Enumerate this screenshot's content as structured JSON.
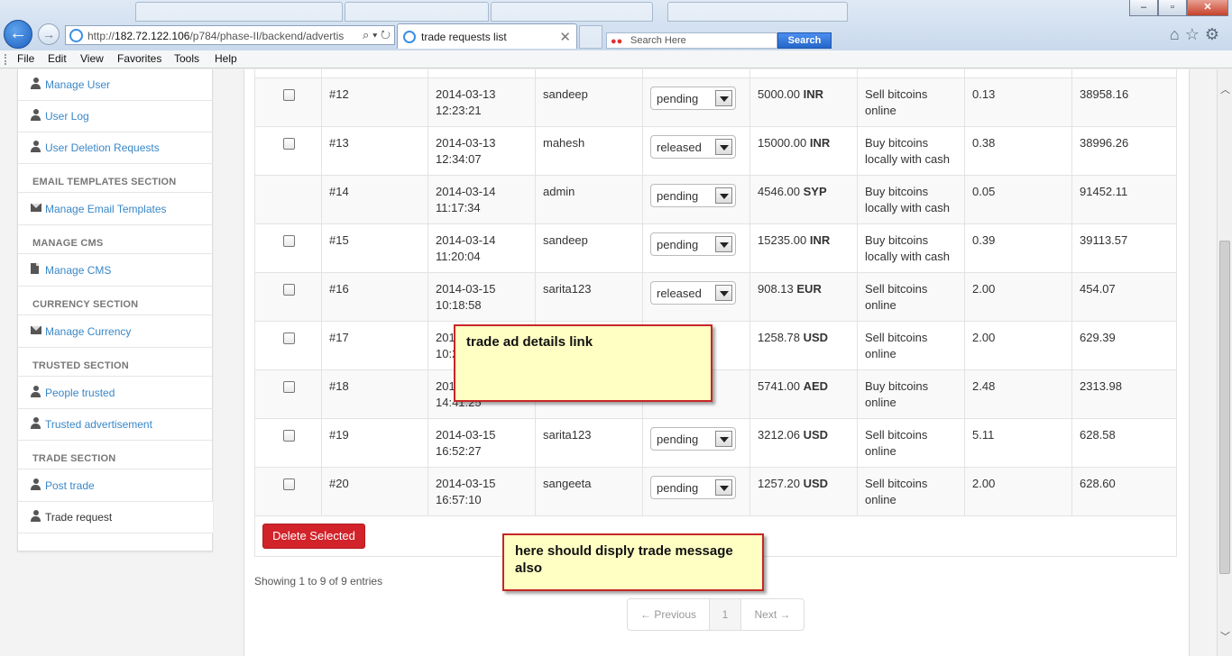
{
  "browser": {
    "address_url_host": "182.72.122.106",
    "address_url_prefix": "http://",
    "address_url_path": "/p784/phase-II/backend/advertis",
    "active_tab_title": "trade requests list",
    "search_placeholder": "Search Here",
    "search_button": "Search",
    "menu": [
      "File",
      "Edit",
      "View",
      "Favorites",
      "Tools",
      "Help"
    ]
  },
  "sidebar": {
    "items": [
      {
        "type": "link",
        "icon": "user-icon",
        "label": "Manage User"
      },
      {
        "type": "link",
        "icon": "user-icon",
        "label": "User Log"
      },
      {
        "type": "link",
        "icon": "user-icon",
        "label": "User Deletion Requests"
      },
      {
        "type": "head",
        "label": "EMAIL TEMPLATES SECTION"
      },
      {
        "type": "link",
        "icon": "envelope-icon",
        "label": "Manage Email Templates"
      },
      {
        "type": "head",
        "label": "MANAGE CMS"
      },
      {
        "type": "link",
        "icon": "document-icon",
        "label": "Manage CMS"
      },
      {
        "type": "head",
        "label": "CURRENCY SECTION"
      },
      {
        "type": "link",
        "icon": "envelope-icon",
        "label": "Manage Currency"
      },
      {
        "type": "head",
        "label": "TRUSTED SECTION"
      },
      {
        "type": "link",
        "icon": "user-icon",
        "label": "People trusted"
      },
      {
        "type": "link",
        "icon": "user-icon",
        "label": "Trusted advertisement"
      },
      {
        "type": "head",
        "label": "TRADE SECTION"
      },
      {
        "type": "link",
        "icon": "user-icon",
        "label": "Post trade"
      },
      {
        "type": "link",
        "icon": "user-icon",
        "label": "Trade request",
        "active": true
      }
    ]
  },
  "table": {
    "rows": [
      {
        "id": "#12",
        "date": "2014-03-13",
        "time": "12:23:21",
        "user": "sandeep",
        "status": "pending",
        "amount": "5000.00",
        "currency": "INR",
        "ad_line1": "Sell bitcoins",
        "ad_line2": "online",
        "btc": "0.13",
        "price": "38958.16",
        "checkbox": true
      },
      {
        "id": "#13",
        "date": "2014-03-13",
        "time": "12:34:07",
        "user": "mahesh",
        "status": "released",
        "amount": "15000.00",
        "currency": "INR",
        "ad_line1": "Buy bitcoins",
        "ad_line2": "locally with cash",
        "btc": "0.38",
        "price": "38996.26",
        "checkbox": true
      },
      {
        "id": "#14",
        "date": "2014-03-14",
        "time": "11:17:34",
        "user": "admin",
        "status": "pending",
        "amount": "4546.00",
        "currency": "SYP",
        "ad_line1": "Buy bitcoins",
        "ad_line2": "locally with cash",
        "btc": "0.05",
        "price": "91452.11",
        "checkbox": false
      },
      {
        "id": "#15",
        "date": "2014-03-14",
        "time": "11:20:04",
        "user": "sandeep",
        "status": "pending",
        "amount": "15235.00",
        "currency": "INR",
        "ad_line1": "Buy bitcoins",
        "ad_line2": "locally with cash",
        "btc": "0.39",
        "price": "39113.57",
        "checkbox": true
      },
      {
        "id": "#16",
        "date": "2014-03-15",
        "time": "10:18:58",
        "user": "sarita123",
        "status": "released",
        "amount": "908.13",
        "currency": "EUR",
        "ad_line1": "Sell bitcoins",
        "ad_line2": "online",
        "btc": "2.00",
        "price": "454.07",
        "checkbox": true
      },
      {
        "id": "#17",
        "date": "201",
        "time": "10:2",
        "user": "",
        "status": "",
        "amount": "1258.78",
        "currency": "USD",
        "ad_line1": "Sell bitcoins",
        "ad_line2": "online",
        "btc": "2.00",
        "price": "629.39",
        "checkbox": true
      },
      {
        "id": "#18",
        "date": "201",
        "time": "14:41:25",
        "user": "",
        "status": "",
        "amount": "5741.00",
        "currency": "AED",
        "ad_line1": "Buy bitcoins",
        "ad_line2": "online",
        "btc": "2.48",
        "price": "2313.98",
        "checkbox": true
      },
      {
        "id": "#19",
        "date": "2014-03-15",
        "time": "16:52:27",
        "user": "sarita123",
        "status": "pending",
        "amount": "3212.06",
        "currency": "USD",
        "ad_line1": "Sell bitcoins",
        "ad_line2": "online",
        "btc": "5.11",
        "price": "628.58",
        "checkbox": true
      },
      {
        "id": "#20",
        "date": "2014-03-15",
        "time": "16:57:10",
        "user": "sangeeta",
        "status": "pending",
        "amount": "1257.20",
        "currency": "USD",
        "ad_line1": "Sell bitcoins",
        "ad_line2": "online",
        "btc": "2.00",
        "price": "628.60",
        "checkbox": true
      }
    ],
    "delete_button": "Delete Selected",
    "showing_text": "Showing 1 to 9 of 9 entries",
    "pager": {
      "previous": "← Previous",
      "page": "1",
      "next": "Next →"
    }
  },
  "annotations": {
    "note1": "trade ad details link",
    "note2": "here should disply trade message also"
  },
  "colors": {
    "link": "#3a87c8",
    "danger": "#d2232a",
    "note_bg": "#ffffc4",
    "note_border": "#c62626"
  }
}
